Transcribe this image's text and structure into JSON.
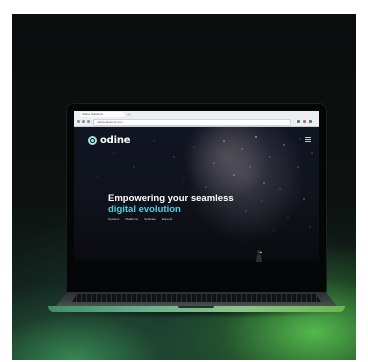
{
  "browser": {
    "tab_title": "Odine Solutions",
    "url": "odinesolutions.com"
  },
  "site": {
    "logo_text": "odine",
    "headline_line1": "Empowering your seamless",
    "headline_line2": "digital evolution",
    "tags": [
      "Systems",
      "Platforms",
      "Software",
      "Experts"
    ]
  },
  "colors": {
    "accent": "#4fd0e0",
    "logo_mark": "#9fe3e6",
    "ambient_green": "#6ab64f"
  }
}
